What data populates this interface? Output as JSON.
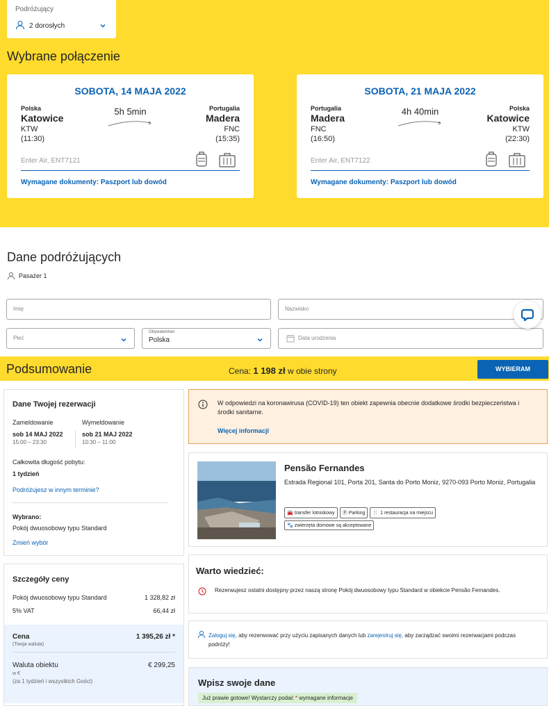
{
  "travelers": {
    "label": "Podróżujący",
    "value": "2 dorosłych"
  },
  "selected_title": "Wybrane połączenie",
  "flights": [
    {
      "date": "SOBOTA, 14 MAJA 2022",
      "from_country": "Polska",
      "from_city": "Katowice",
      "from_code": "KTW",
      "from_time": "(11:30)",
      "duration": "5h 5min",
      "to_country": "Portugalia",
      "to_city": "Madera",
      "to_code": "FNC",
      "to_time": "(15:35)",
      "airline": "Enter Air, ENT7121",
      "docs": "Wymagane dokumenty: Paszport lub dowód"
    },
    {
      "date": "SOBOTA, 21 MAJA 2022",
      "from_country": "Portugalia",
      "from_city": "Madera",
      "from_code": "FNC",
      "from_time": "(16:50)",
      "duration": "4h 40min",
      "to_country": "Polska",
      "to_city": "Katowice",
      "to_code": "KTW",
      "to_time": "(22:30)",
      "airline": "Enter Air, ENT7122",
      "docs": "Wymagane dokumenty: Paszport lub dowód"
    }
  ],
  "passengers": {
    "title": "Dane podróżujących",
    "passenger_label": "Pasażer 1",
    "first_name_placeholder": "Imię",
    "last_name_placeholder": "Nazwisko",
    "gender_placeholder": "Płeć",
    "citizenship_label": "Obywatelstwo",
    "citizenship_value": "Polska",
    "birthdate_placeholder": "Data urodzenia"
  },
  "summary": {
    "title": "Podsumowanie",
    "price_prefix": "Cena: ",
    "price_value": "1 198 zł",
    "price_suffix": " w obie strony",
    "choose_button": "WYBIERAM"
  },
  "booking": {
    "title": "Dane Twojej rezerwacji",
    "checkin_label": "Zameldowanie",
    "checkout_label": "Wymeldowanie",
    "checkin_date": "sob 14 MAJ 2022",
    "checkout_date": "sob 21 MAJ 2022",
    "checkin_time": "15:00 – 23:30",
    "checkout_time": "10:30 – 11:00",
    "length_label": "Całkowita długość pobytu:",
    "length_value": "1 tydzień",
    "other_dates_link": "Podróżujesz w innym terminie?",
    "selected_label": "Wybrano:",
    "selected_value": "Pokój dwuosobowy typu Standard",
    "change_link": "Zmień wybór"
  },
  "price_details": {
    "title": "Szczegóły ceny",
    "room_label": "Pokój dwuosobowy typu Standard",
    "room_value": "1 328,82 zł",
    "vat_label": "5% VAT",
    "vat_value": "66,44 zł",
    "price_label": "Cena",
    "price_value": "1 395,26 zł *",
    "price_sub": "(Twoja waluta)",
    "local_label": "Waluta obiektu",
    "local_value": "€ 299,25",
    "local_sub1": "w €",
    "local_sub2": "(za 1 tydzień i wszystkich Gości)"
  },
  "covid": {
    "text": "W odpowiedzi na koronawirusa (COVID-19) ten obiekt zapewnia obecnie dodatkowe środki bezpieczeństwa i środki sanitarne.",
    "link": "Więcej informacji"
  },
  "hotel": {
    "name": "Pensão Fernandes",
    "address": "Estrada Regional 101, Porta 201, Santa do Porto Moniz, 9270-093 Porto Moniz, Portugalia",
    "facilities_row1": [
      "transfer lotniskowy",
      "Parking",
      "1 restauracja na miejscu"
    ],
    "facilities_row2": [
      "zwierzęta domowe są akceptowane"
    ]
  },
  "worth_knowing": {
    "title": "Warto wiedzieć:",
    "text": "Rezerwujesz ostatni dostępny przez naszą stronę Pokój dwuosobowy typu Standard w obiekcie Pensão Fernandes."
  },
  "login": {
    "link1": "Zaloguj się",
    "text1": ", aby rezerwować przy użyciu zapisanych danych lub ",
    "link2": "zarejestruj się",
    "text2": ", aby zarządzać swoimi rezerwacjami podczas podróży!"
  },
  "enter_data": {
    "title": "Wpisz swoje dane",
    "note_prefix": "Już prawie gotowe! Wystarczy podać ",
    "note_star": "*",
    "note_suffix": " wymagane informacje"
  },
  "colors": {
    "accent_yellow": "#fedb2d",
    "link_blue": "#0a63b4"
  }
}
